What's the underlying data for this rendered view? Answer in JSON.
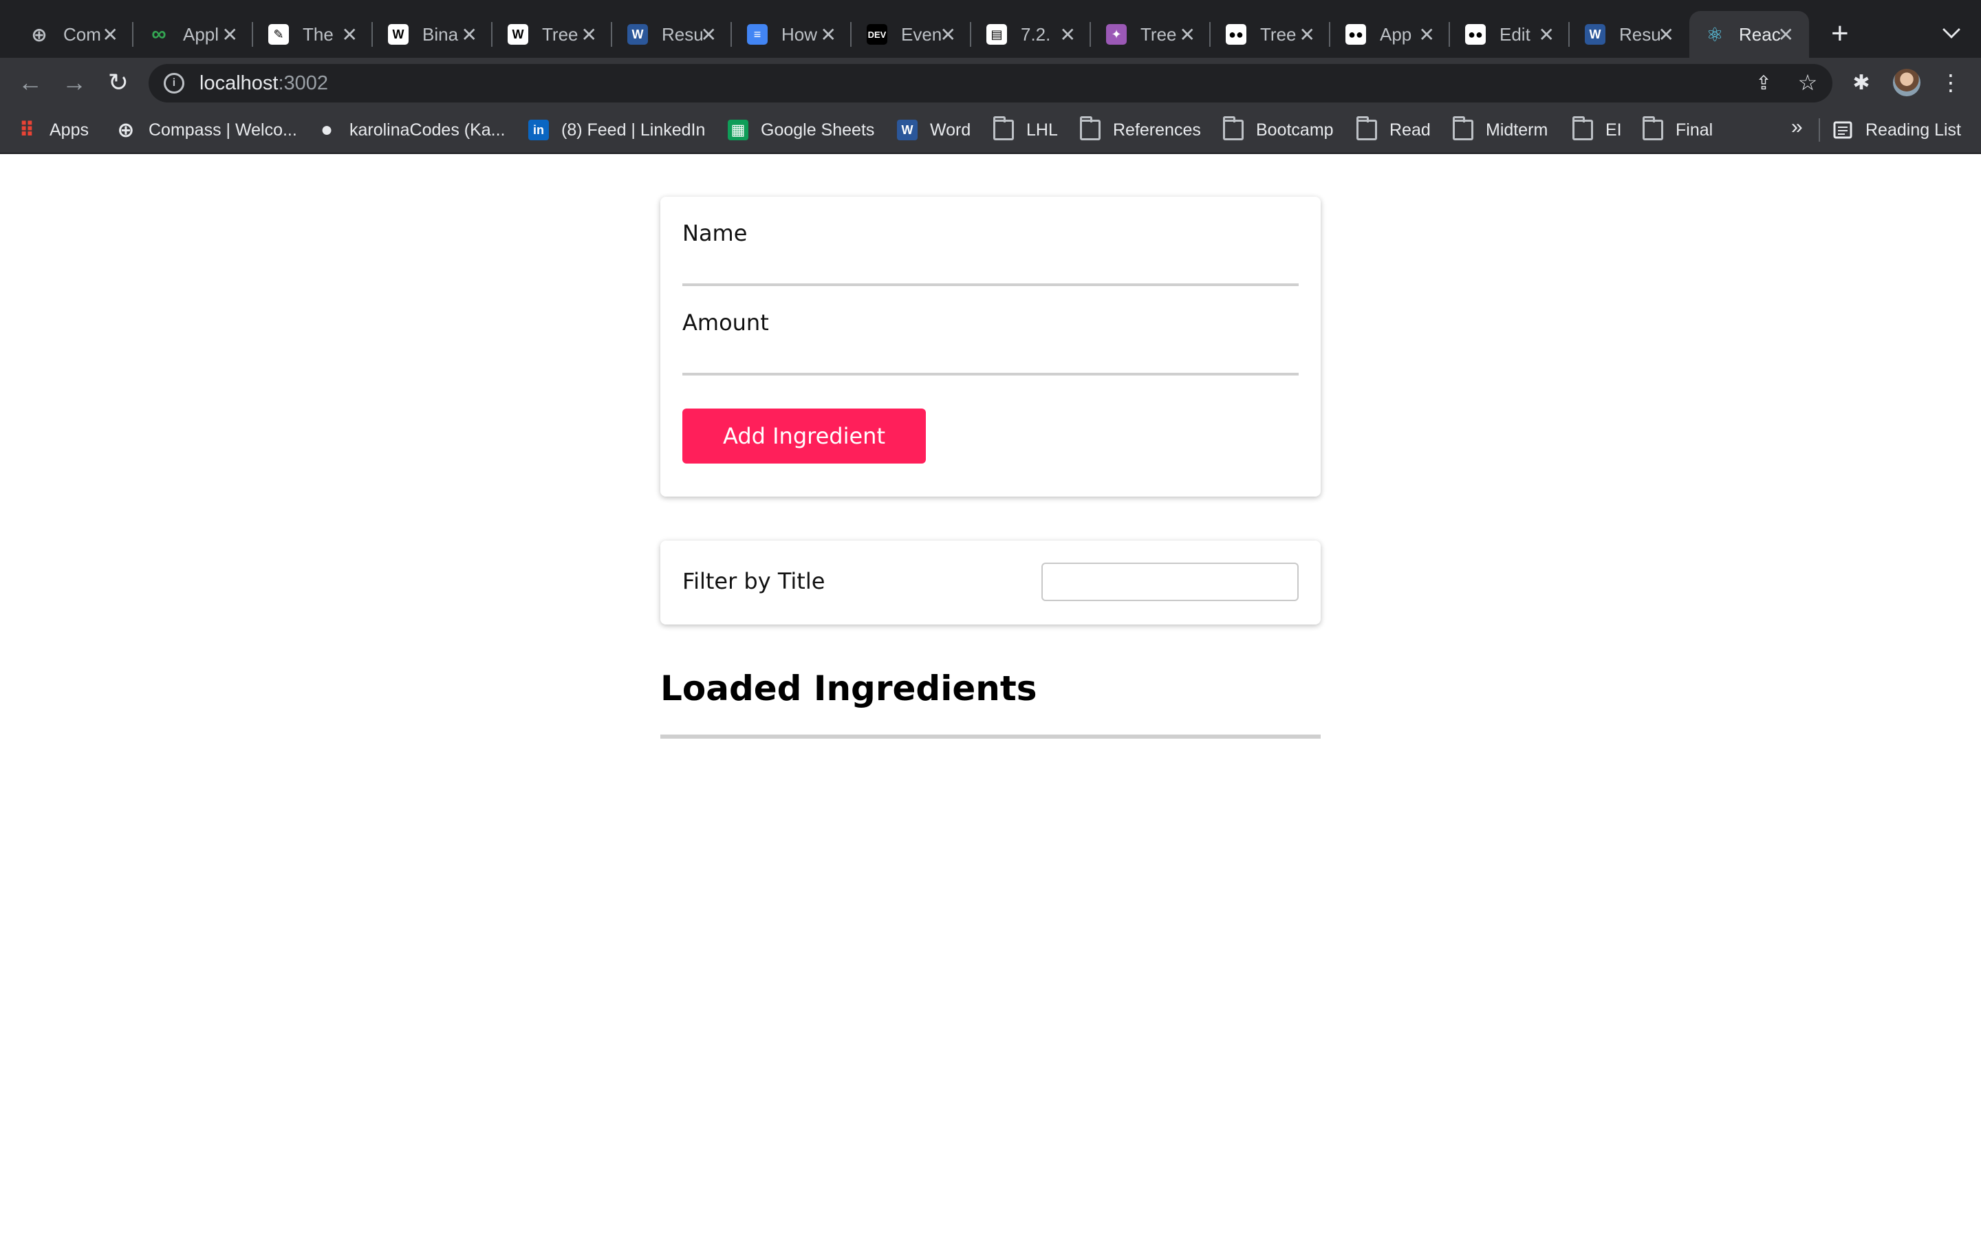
{
  "browser": {
    "tabs": [
      {
        "label": "Com",
        "icon": "compass-icon",
        "color": "#202124"
      },
      {
        "label": "Appl",
        "icon": "infinity-icon",
        "color": "#34a853"
      },
      {
        "label": "The",
        "icon": "pen-nib-icon",
        "color": "#ffffff"
      },
      {
        "label": "Bina",
        "icon": "wikipedia-icon",
        "color": "#ffffff"
      },
      {
        "label": "Tree",
        "icon": "wikipedia-icon",
        "color": "#ffffff"
      },
      {
        "label": "Resu",
        "icon": "word-icon",
        "color": "#2b579a"
      },
      {
        "label": "How",
        "icon": "stack-icon",
        "color": "#4285f4"
      },
      {
        "label": "Even",
        "icon": "dev-icon",
        "color": "#000000"
      },
      {
        "label": "7.2.",
        "icon": "book-icon",
        "color": "#ffffff"
      },
      {
        "label": "Tree",
        "icon": "galaxy-icon",
        "color": "#9b59b6"
      },
      {
        "label": "Tree",
        "icon": "medium-icon",
        "color": "#ffffff"
      },
      {
        "label": "App",
        "icon": "medium-icon",
        "color": "#ffffff"
      },
      {
        "label": "Edit",
        "icon": "medium-icon",
        "color": "#ffffff"
      },
      {
        "label": "Resu",
        "icon": "word-icon",
        "color": "#2b579a"
      },
      {
        "label": "Reac",
        "icon": "react-icon",
        "color": "#61dafb",
        "active": true
      }
    ],
    "url_host": "localhost",
    "url_port": ":3002",
    "bookmarks": [
      {
        "label": "Apps",
        "icon": "apps-grid-icon"
      },
      {
        "label": "Compass | Welco...",
        "icon": "compass-icon"
      },
      {
        "label": "karolinaCodes (Ka...",
        "icon": "github-icon"
      },
      {
        "label": "(8) Feed | LinkedIn",
        "icon": "linkedin-icon"
      },
      {
        "label": "Google Sheets",
        "icon": "sheets-icon"
      },
      {
        "label": "Word",
        "icon": "word-icon"
      },
      {
        "label": "LHL",
        "icon": "folder-icon"
      },
      {
        "label": "References",
        "icon": "folder-icon"
      },
      {
        "label": "Bootcamp",
        "icon": "folder-icon"
      },
      {
        "label": "Read",
        "icon": "folder-icon"
      },
      {
        "label": "Midterm",
        "icon": "folder-icon"
      },
      {
        "label": "EI",
        "icon": "folder-icon"
      },
      {
        "label": "Final",
        "icon": "folder-icon"
      }
    ],
    "overflow_label": "»",
    "reading_list": "Reading List"
  },
  "form": {
    "name_label": "Name",
    "name_value": "",
    "amount_label": "Amount",
    "amount_value": "",
    "submit_label": "Add Ingredient"
  },
  "filter": {
    "label": "Filter by Title",
    "value": ""
  },
  "list": {
    "title": "Loaded Ingredients",
    "items": []
  },
  "colors": {
    "accent": "#ff1f5a",
    "chrome_dark": "#202124",
    "chrome_mid": "#35363a"
  }
}
